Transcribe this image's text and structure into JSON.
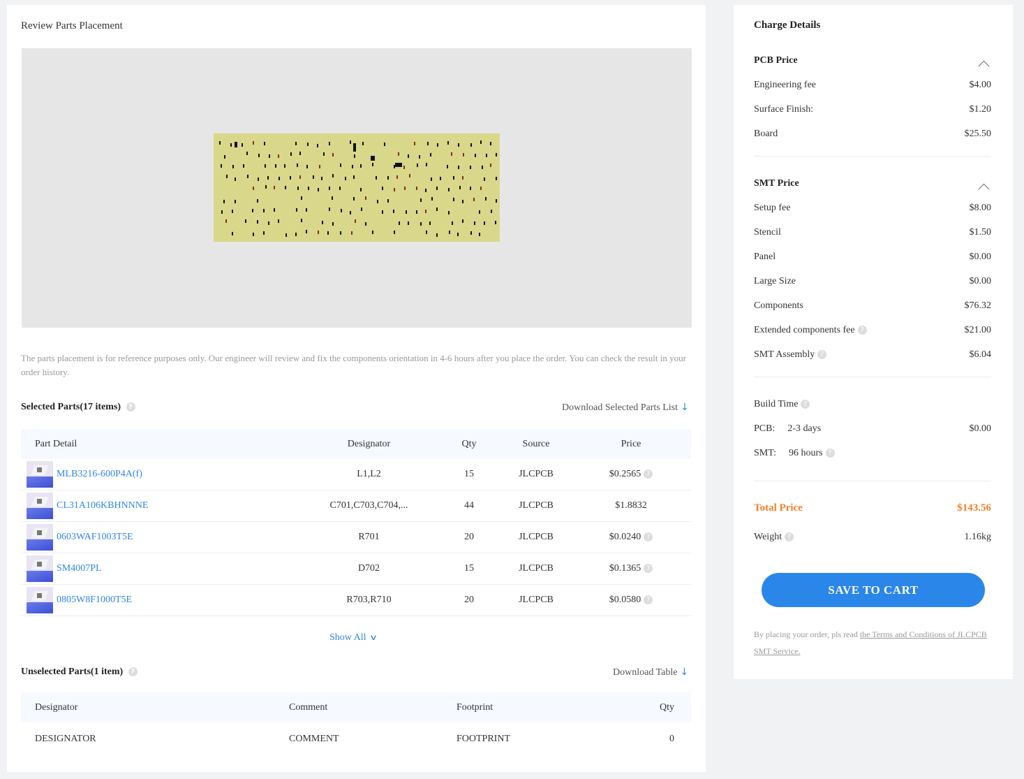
{
  "review": {
    "title": "Review Parts Placement",
    "note": "The parts placement is for reference purposes only. Our engineer will review and fix the components orientation in 4-6 hours after you place the order. You can check the result in your order history."
  },
  "selected": {
    "title": "Selected Parts(17 items)",
    "download": "Download Selected Parts List",
    "columns": [
      "Part Detail",
      "Designator",
      "Qty",
      "Source",
      "Price"
    ],
    "rows": [
      {
        "part": "MLB3216-600P4A(f)",
        "designator": "L1,L2",
        "qty": "15",
        "source": "JLCPCB",
        "price": "$0.2565",
        "help": true
      },
      {
        "part": "CL31A106KBHNNNE",
        "designator": "C701,C703,C704,...",
        "qty": "44",
        "source": "JLCPCB",
        "price": "$1.8832",
        "help": false
      },
      {
        "part": "0603WAF1003T5E",
        "designator": "R701",
        "qty": "20",
        "source": "JLCPCB",
        "price": "$0.0240",
        "help": true
      },
      {
        "part": "SM4007PL",
        "designator": "D702",
        "qty": "15",
        "source": "JLCPCB",
        "price": "$0.1365",
        "help": true
      },
      {
        "part": "0805W8F1000T5E",
        "designator": "R703,R710",
        "qty": "20",
        "source": "JLCPCB",
        "price": "$0.0580",
        "help": true
      }
    ],
    "show_all": "Show All"
  },
  "unselected": {
    "title": "Unselected Parts(1 item)",
    "download": "Download Table",
    "columns": [
      "Designator",
      "Comment",
      "Footprint",
      "Qty"
    ],
    "rows": [
      {
        "designator": "DESIGNATOR",
        "comment": "COMMENT",
        "footprint": "FOOTPRINT",
        "qty": "0"
      }
    ]
  },
  "charge": {
    "title": "Charge Details",
    "pcb": {
      "heading": "PCB Price",
      "items": [
        {
          "label": "Engineering fee",
          "value": "$4.00"
        },
        {
          "label": "Surface Finish:",
          "value": "$1.20"
        },
        {
          "label": "Board",
          "value": "$25.50"
        }
      ]
    },
    "smt": {
      "heading": "SMT Price",
      "items": [
        {
          "label": "Setup fee",
          "value": "$8.00"
        },
        {
          "label": "Stencil",
          "value": "$1.50"
        },
        {
          "label": "Panel",
          "value": "$0.00"
        },
        {
          "label": "Large Size",
          "value": "$0.00"
        },
        {
          "label": "Components",
          "value": "$76.32"
        },
        {
          "label": "Extended components fee",
          "value": "$21.00"
        },
        {
          "label": "SMT Assembly",
          "value": "$6.04"
        }
      ]
    },
    "build": {
      "heading": "Build Time",
      "pcb_label": "PCB:",
      "pcb_time": "2-3 days",
      "pcb_value": "$0.00",
      "smt_label": "SMT:",
      "smt_time": "96 hours"
    },
    "total_label": "Total Price",
    "total_value": "$143.56",
    "weight_label": "Weight",
    "weight_value": "1.16kg",
    "save_button": "SAVE TO CART",
    "terms_prefix": "By placing your order, pls read ",
    "terms_link": "the Terms and Conditions of JLCPCB SMT Service."
  },
  "colors": {
    "accent": "#2b86ea",
    "total": "#f47f2a",
    "pcb_board": "#d9d78a"
  }
}
